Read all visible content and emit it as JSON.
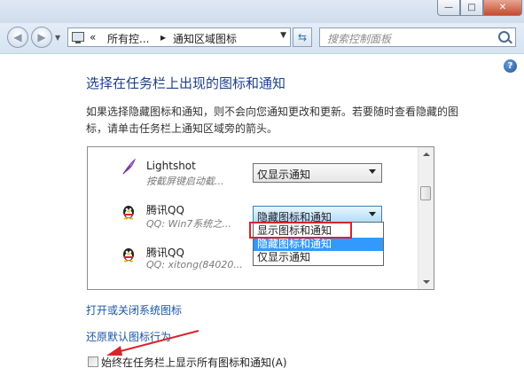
{
  "window": {
    "buttons": {
      "minimize": "—",
      "maximize": "□",
      "close": "✕"
    }
  },
  "navigation": {
    "address_crumbs": [
      "«",
      "所有控...",
      "▸",
      "通知区域图标"
    ],
    "search_placeholder": "搜索控制面板"
  },
  "page": {
    "heading": "选择在任务栏上出现的图标和通知",
    "description": "如果选择隐藏图标和通知，则不会向您通知更改和更新。若要随时查看隐藏的图标，请单击任务栏上通知区域旁的箭头。",
    "help": "?"
  },
  "icon_list": {
    "items": [
      {
        "name": "Lightshot",
        "subtitle": "按截屏键启动截...",
        "behavior": "仅显示通知",
        "icon": "feather-icon"
      },
      {
        "name": "腾讯QQ",
        "subtitle": "QQ: Win7系统之...",
        "behavior": "隐藏图标和通知",
        "icon": "qq-penguin-icon"
      },
      {
        "name": "腾讯QQ",
        "subtitle": "QQ: xitong(84020...",
        "behavior": "",
        "icon": "qq-penguin-icon"
      }
    ],
    "dropdown_options": [
      "显示图标和通知",
      "隐藏图标和通知",
      "仅显示通知"
    ],
    "selected_option_index": 1,
    "highlighted_option_index": 0
  },
  "links": {
    "system_icons": "打开或关闭系统图标",
    "restore_defaults": "还原默认图标行为"
  },
  "always_show": {
    "label": "始终在任务栏上显示所有图标和通知(A)",
    "checked": false
  },
  "colors": {
    "heading": "#1e3f8c",
    "link": "#1a55a5",
    "selection": "#3399ff",
    "annotation": "#d8232a"
  }
}
